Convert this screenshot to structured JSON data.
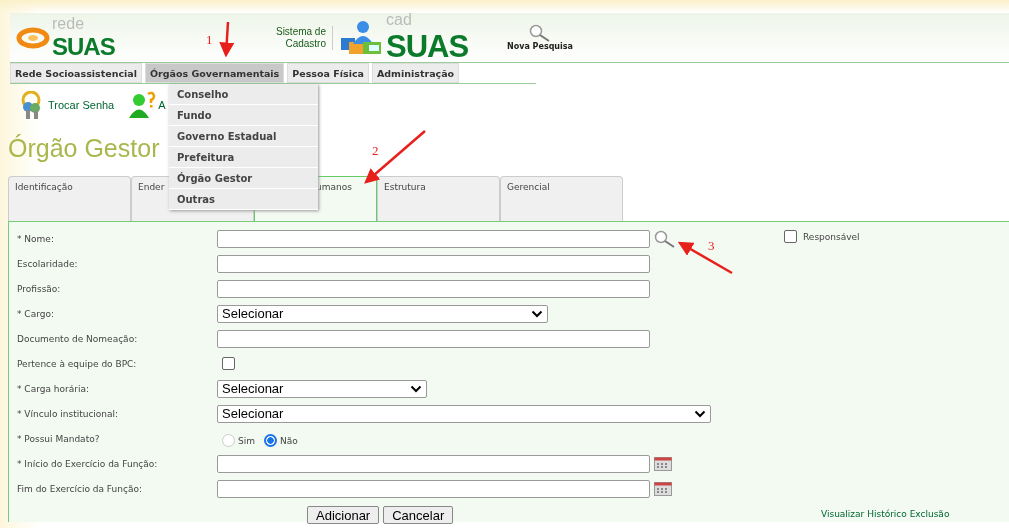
{
  "header": {
    "logo_left": {
      "small": "rede",
      "big": "SUAS"
    },
    "system_label": "Sistema de Cadastro",
    "logo_right": {
      "small": "cad",
      "big": "SUAS"
    },
    "search_link": "Nova Pesquisa"
  },
  "menu": [
    {
      "label": "Rede Socioassistencial",
      "selected": false
    },
    {
      "label": "Órgãos Governamentais",
      "selected": true
    },
    {
      "label": "Pessoa Física",
      "selected": false
    },
    {
      "label": "Administração",
      "selected": false
    }
  ],
  "dropdown": [
    "Conselho",
    "Fundo",
    "Governo Estadual",
    "Prefeitura",
    "Órgão Gestor",
    "Outras"
  ],
  "shortcuts": [
    {
      "label": "Trocar Senha"
    },
    {
      "label": "A"
    }
  ],
  "page_title": "Órgão Gestor",
  "tabs": [
    {
      "label": "Identificação",
      "selected": false
    },
    {
      "label": "Ender",
      "selected": false
    },
    {
      "label": "umanos",
      "selected": true
    },
    {
      "label": "Estrutura",
      "selected": false
    },
    {
      "label": "Gerencial",
      "selected": false
    }
  ],
  "form": {
    "rows": [
      {
        "label": "* Nome:",
        "kind": "lookup"
      },
      {
        "label": "Escolaridade:",
        "kind": "input"
      },
      {
        "label": "Profissão:",
        "kind": "input"
      },
      {
        "label": "* Cargo:",
        "kind": "select",
        "value": "Selecionar"
      },
      {
        "label": "Documento de Nomeação:",
        "kind": "input"
      },
      {
        "label": "Pertence à equipe do BPC:",
        "kind": "checkbox",
        "checked": false
      },
      {
        "label": "* Carga horária:",
        "kind": "select",
        "value": "Selecionar"
      },
      {
        "label": "* Vínculo institucional:",
        "kind": "select",
        "value": "Selecionar"
      },
      {
        "label": "* Possui Mandato?",
        "kind": "radio",
        "options": [
          {
            "label": "Sim",
            "selected": false
          },
          {
            "label": "Não",
            "selected": true
          }
        ]
      },
      {
        "label": "* Início do Exercício da Função:",
        "kind": "date"
      },
      {
        "label": "Fim do Exercício da Função:",
        "kind": "date"
      }
    ],
    "responsible": {
      "label": "Responsável",
      "checked": false
    },
    "buttons": [
      "Adicionar",
      "Cancelar"
    ],
    "history_link": "Visualizar Histórico Exclusão"
  },
  "annotations": [
    {
      "label": "1"
    },
    {
      "label": "2"
    },
    {
      "label": "3"
    }
  ]
}
